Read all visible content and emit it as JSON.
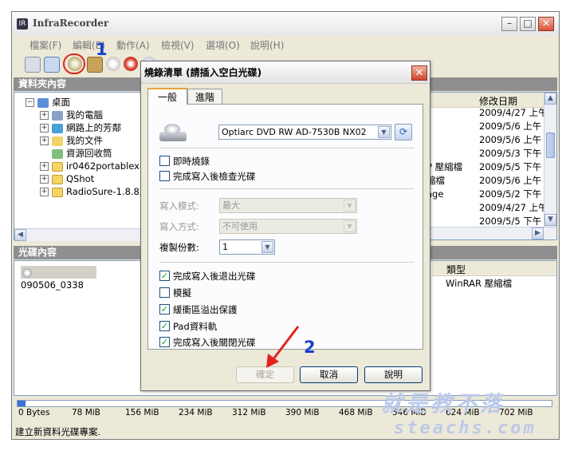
{
  "window": {
    "title": "InfraRecorder",
    "menu": [
      "檔案(F)",
      "編輯(E)",
      "動作(A)",
      "檢視(V)",
      "選項(O)",
      "說明(H)"
    ]
  },
  "folder_panel": {
    "header": "資料夾內容",
    "tree": [
      {
        "label": "桌面",
        "expander": "−",
        "icon": "desktop-icon"
      },
      {
        "label": "我的電腦",
        "expander": "+",
        "icon": "computer-icon"
      },
      {
        "label": "網路上的芳鄰",
        "expander": "+",
        "icon": "network-icon"
      },
      {
        "label": "我的文件",
        "expander": "+",
        "icon": "documents-icon"
      },
      {
        "label": "資源回收筒",
        "expander": "",
        "icon": "recycle-bin-icon"
      },
      {
        "label": "ir0462portablex86",
        "expander": "+",
        "icon": "folder-icon"
      },
      {
        "label": "QShot",
        "expander": "+",
        "icon": "folder-icon"
      },
      {
        "label": "RadioSure-1.8.820",
        "expander": "+",
        "icon": "folder-icon"
      }
    ],
    "list_header_modified": "修改日期",
    "list_dates": [
      "2009/4/27 上午",
      "2009/5/6 上午 (",
      "2009/5/6 上午 (",
      "2009/5/3 下午 1",
      "2009/5/5 下午 (",
      "2009/5/6 上午 1",
      "2009/5/2 下午 1",
      "2009/4/27 上午",
      "2009/5/5 下午"
    ],
    "list_type_fragments": [
      "",
      "",
      "",
      "",
      "P 壓縮檔",
      "縮檔",
      "age",
      "",
      ""
    ]
  },
  "disc_panel": {
    "header": "光碟內容",
    "tree_item": "090506_0338",
    "type_header": "類型",
    "type_value": "WinRAR 壓縮檔"
  },
  "ruler_labels": [
    "0 Bytes",
    "78 MiB",
    "156 MiB",
    "234 MiB",
    "312 MiB",
    "390 MiB",
    "468 MiB",
    "546 MiB",
    "624 MiB",
    "702 MiB"
  ],
  "status": "建立新資料光碟專案.",
  "dialog": {
    "title": "燒錄清單 (請插入空白光碟)",
    "tabs": [
      "一般",
      "進階"
    ],
    "drive": "Optiarc DVD RW AD-7530B NX02",
    "checks_top": [
      {
        "label": "即時燒錄",
        "checked": false
      },
      {
        "label": "完成寫入後檢查光碟",
        "checked": false
      }
    ],
    "write_mode_label": "寫入模式:",
    "write_mode_value": "最大",
    "write_method_label": "寫入方式:",
    "write_method_value": "不可使用",
    "copies_label": "複製份數:",
    "copies_value": "1",
    "checks_bottom": [
      {
        "label": "完成寫入後退出光碟",
        "checked": true
      },
      {
        "label": "模擬",
        "checked": false
      },
      {
        "label": "緩衝區溢出保護",
        "checked": true
      },
      {
        "label": "Pad資料軌",
        "checked": true
      },
      {
        "label": "完成寫入後關閉光碟",
        "checked": true
      }
    ],
    "buttons": {
      "ok": "確定",
      "cancel": "取消",
      "help": "說明"
    }
  },
  "annotations": {
    "step1": "1",
    "step2": "2"
  },
  "watermark": {
    "line1": "就是教不落",
    "line2": "steachs.com"
  },
  "colors": {
    "annotation_blue": "#1a3fd0",
    "arrow_red": "#e0231b",
    "panel_header": "#8f8f8f"
  }
}
